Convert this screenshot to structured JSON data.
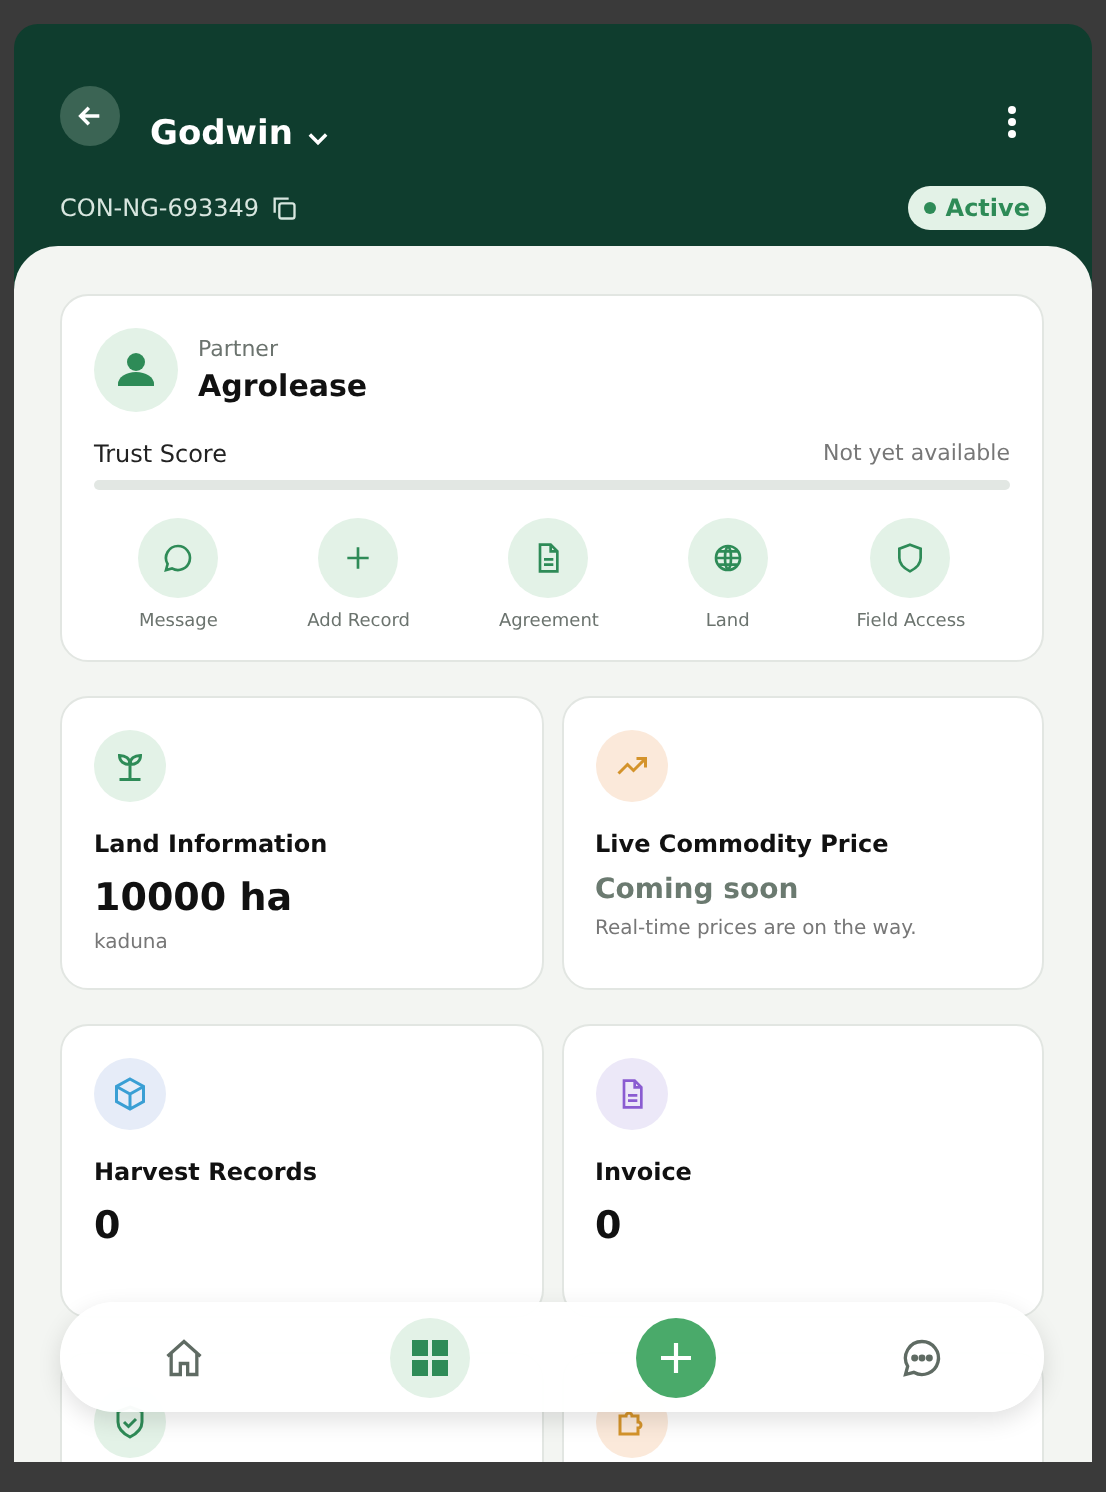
{
  "header": {
    "title": "Godwin",
    "contract_id": "CON-NG-693349",
    "status": {
      "label": "Active",
      "active": true
    }
  },
  "partner": {
    "label": "Partner",
    "name": "Agrolease"
  },
  "trust_score": {
    "label": "Trust Score",
    "value_text": "Not yet available"
  },
  "actions": [
    {
      "label": "Message",
      "kind": "chat"
    },
    {
      "label": "Add Record",
      "kind": "plus"
    },
    {
      "label": "Agreement",
      "kind": "document"
    },
    {
      "label": "Land",
      "kind": "globe"
    },
    {
      "label": "Field Access",
      "kind": "shield"
    }
  ],
  "cards": [
    {
      "kind": "land",
      "title": "Land Information",
      "value": "10000 ha",
      "note": "kaduna"
    },
    {
      "kind": "price",
      "title": "Live Commodity Price",
      "value": "Coming soon",
      "note": "Real-time prices are on the way."
    },
    {
      "kind": "harvest",
      "title": "Harvest Records",
      "value": "0"
    },
    {
      "kind": "invoice",
      "title": "Invoice",
      "value": "0"
    },
    {
      "kind": "compliance"
    },
    {
      "kind": "puzzle"
    }
  ],
  "nav": [
    {
      "kind": "home",
      "selected": false
    },
    {
      "kind": "grid",
      "selected": true
    },
    {
      "kind": "add",
      "selected": false
    },
    {
      "kind": "chat",
      "selected": false
    }
  ]
}
